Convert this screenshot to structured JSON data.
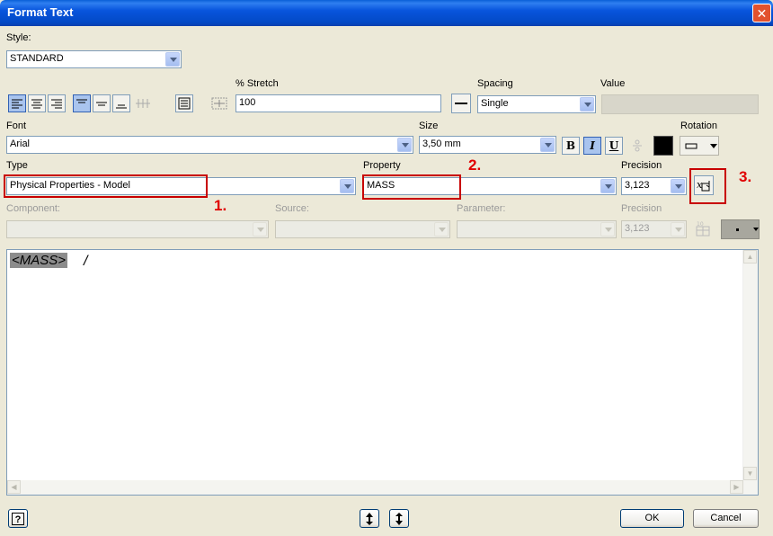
{
  "window": {
    "title": "Format Text",
    "close_glyph": "✕"
  },
  "style": {
    "label": "Style:",
    "value": "STANDARD"
  },
  "stretch": {
    "label": "% Stretch",
    "value": "100"
  },
  "spacing": {
    "label": "Spacing",
    "value": "Single"
  },
  "value_field": {
    "label": "Value",
    "value": ""
  },
  "font": {
    "label": "Font",
    "value": "Arial"
  },
  "size": {
    "label": "Size",
    "value": "3,50 mm"
  },
  "format_buttons": {
    "bold": "B",
    "italic": "I",
    "underline": "U"
  },
  "text_color": "#000000",
  "rotation": {
    "label": "Rotation"
  },
  "type": {
    "label": "Type",
    "value": "Physical Properties - Model"
  },
  "property": {
    "label": "Property",
    "value": "MASS"
  },
  "precision": {
    "label": "Precision",
    "value": "3,123"
  },
  "component": {
    "label": "Component:",
    "value": ""
  },
  "source": {
    "label": "Source:",
    "value": ""
  },
  "parameter": {
    "label": "Parameter:",
    "value": ""
  },
  "precision2": {
    "label": "Precision",
    "value": "3,123"
  },
  "annotations": {
    "one": "1.",
    "two": "2.",
    "three": "3."
  },
  "editor": {
    "content": "<MASS>"
  },
  "buttons": {
    "ok": "OK",
    "cancel": "Cancel",
    "help": "?"
  },
  "icons": [
    "align-left-icon",
    "align-center-icon",
    "align-right-icon",
    "valign-top-icon",
    "valign-middle-icon",
    "valign-bottom-icon",
    "stack-icon",
    "text-frame-icon",
    "stretch-icon",
    "spacing-icon",
    "color-swatch-icon",
    "rotation-icon",
    "add-parameter-icon",
    "insert-symbol-icon",
    "move-up-icon",
    "move-down-icon",
    "help-icon"
  ],
  "colors": {
    "titlebar": "#0855dd",
    "annotation": "#c80000",
    "highlight": "#8c8c8c"
  }
}
